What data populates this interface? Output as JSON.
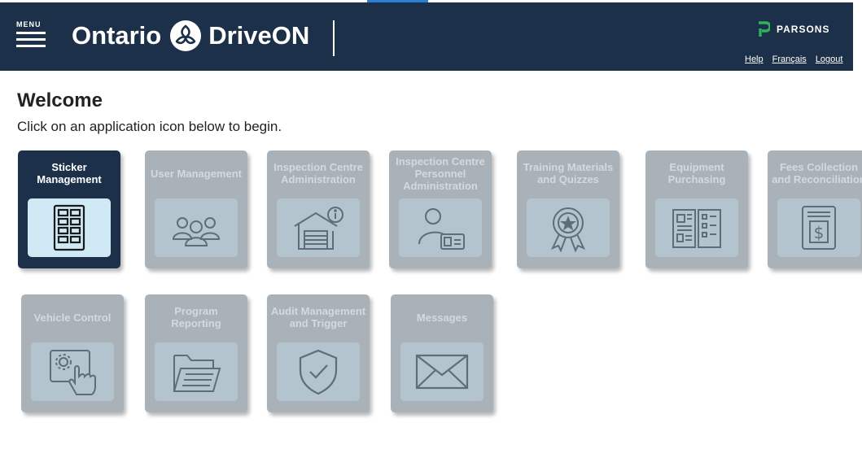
{
  "header": {
    "menu_label": "MENU",
    "brand_ontario": "Ontario",
    "brand_driveon": "DriveON",
    "partner": "PARSONS",
    "links": {
      "help": "Help",
      "francais": "Français",
      "logout": "Logout"
    }
  },
  "welcome": {
    "title": "Welcome",
    "subtitle": "Click on an application icon below to begin."
  },
  "colors": {
    "header_bg": "#1c3149",
    "tile_active_bg": "#1c3149",
    "tile_disabled_bg": "#aab2b9",
    "icon_box_active": "#cfeaf5",
    "icon_box_disabled": "#b3c4ce",
    "parsons_accent": "#2fb25b"
  },
  "tiles": [
    {
      "label": "Sticker Management",
      "icon": "grid-form-icon",
      "active": true
    },
    {
      "label": "User Management",
      "icon": "users-group-icon",
      "active": false
    },
    {
      "label": "Inspection Centre Administration",
      "icon": "garage-info-icon",
      "active": false
    },
    {
      "label": "Inspection Centre Personnel Administration",
      "icon": "person-id-card-icon",
      "active": false
    },
    {
      "label": "Training Materials and Quizzes",
      "icon": "award-ribbon-icon",
      "active": false
    },
    {
      "label": "Equipment Purchasing",
      "icon": "catalog-icon",
      "active": false
    },
    {
      "label": "Fees Collection and Reconciliation",
      "icon": "receipt-dollar-icon",
      "active": false
    },
    {
      "label": "Vehicle Control",
      "icon": "tablet-touch-icon",
      "active": false
    },
    {
      "label": "Program Reporting",
      "icon": "folder-report-icon",
      "active": false
    },
    {
      "label": "Audit Management and Trigger",
      "icon": "shield-check-icon",
      "active": false
    },
    {
      "label": "Messages",
      "icon": "envelope-icon",
      "active": false
    }
  ]
}
